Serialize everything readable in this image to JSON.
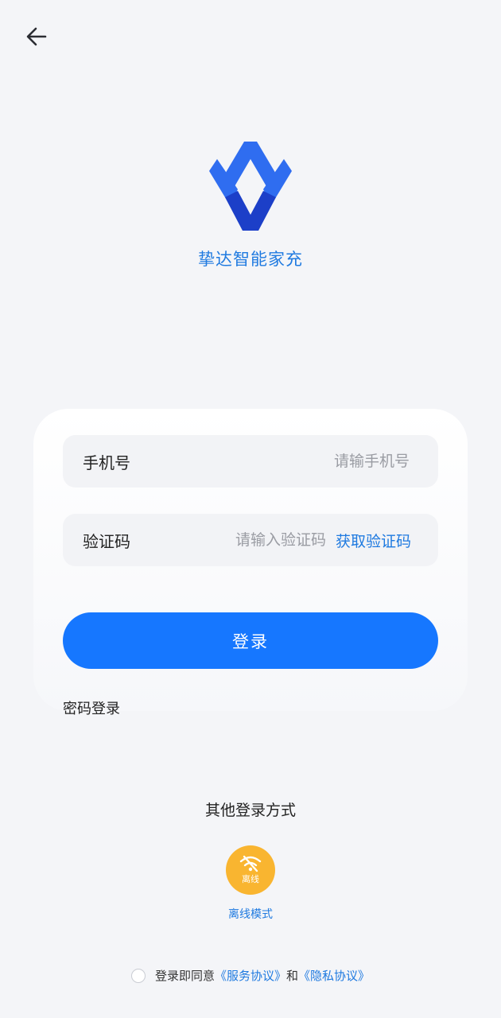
{
  "header": {
    "back_icon": "arrow-left-icon"
  },
  "brand": {
    "app_name": "挚达智能家充",
    "logo_colors": [
      "#2f6df0",
      "#1c3fc8"
    ]
  },
  "form": {
    "phone": {
      "label": "手机号",
      "placeholder": "请输手机号",
      "value": ""
    },
    "code": {
      "label": "验证码",
      "placeholder": "请输入验证码",
      "value": "",
      "get_code_label": "获取验证码"
    },
    "login_label": "登录",
    "password_login_label": "密码登录"
  },
  "other_login": {
    "title": "其他登录方式",
    "offline_button_text": "离线",
    "offline_label": "离线模式",
    "offline_icon": "wifi-off-icon",
    "offline_color": "#f9b530"
  },
  "agreement": {
    "prefix": "登录即同意",
    "service_link": "《服务协议》",
    "and": "和",
    "privacy_link": "《隐私协议》"
  },
  "colors": {
    "accent": "#1677ff",
    "link": "#1f7ae0",
    "background": "#f4f5f8"
  }
}
